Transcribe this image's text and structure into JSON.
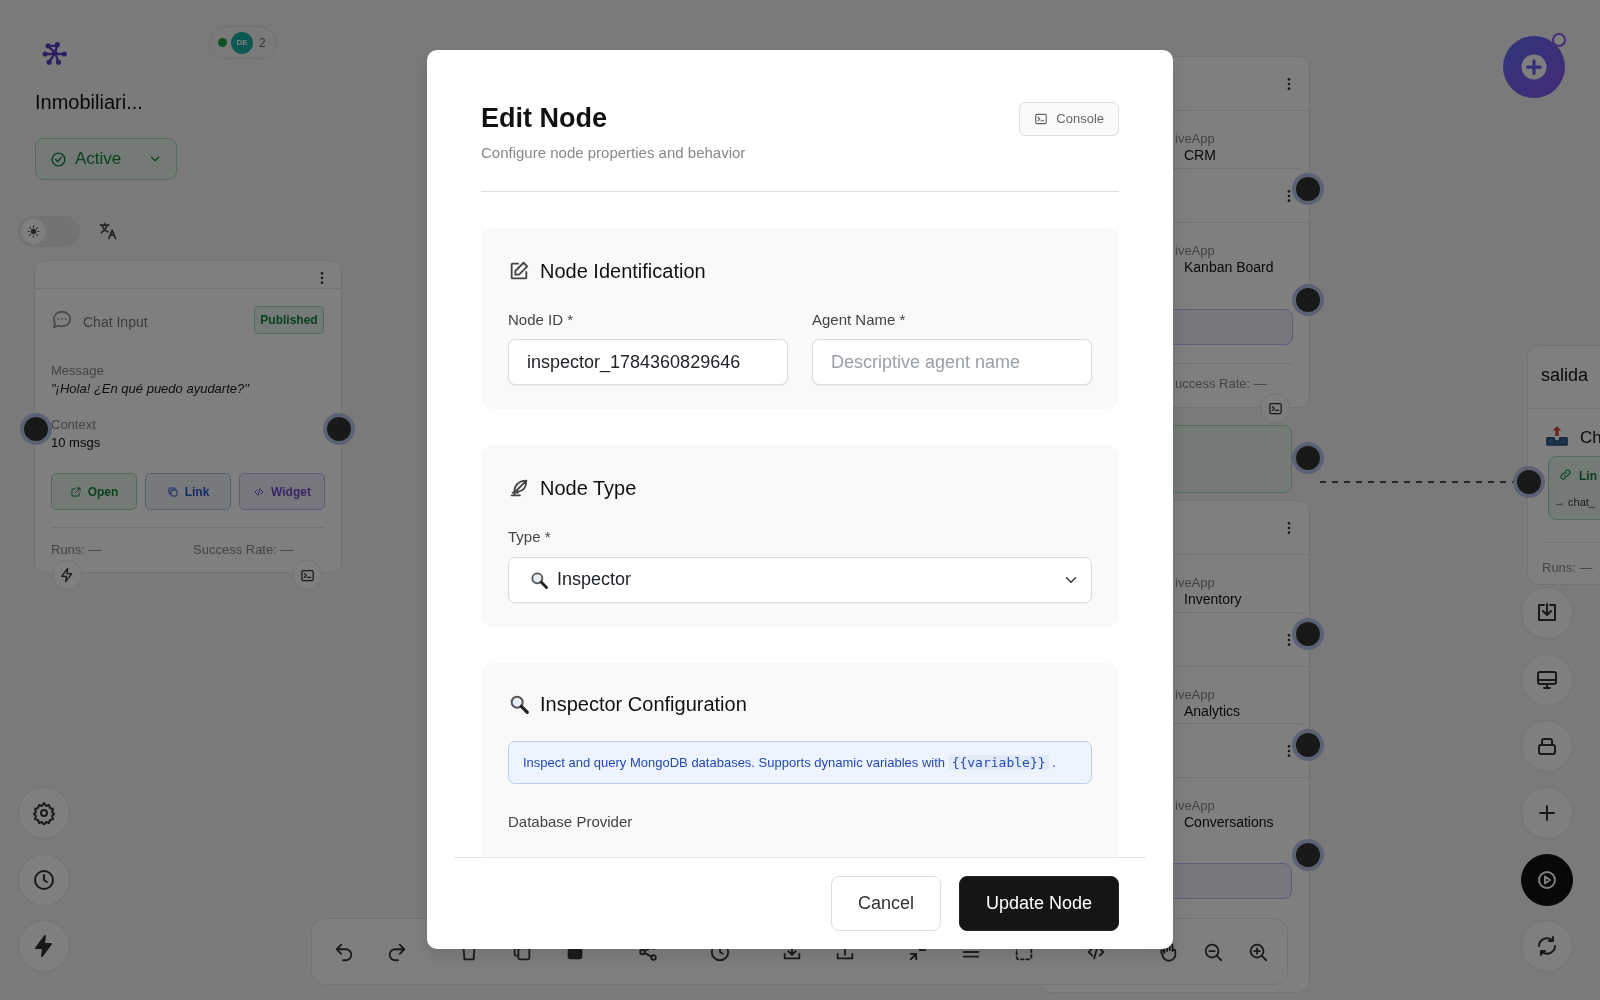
{
  "workflow_panel": {
    "title": "Inmobiliari...",
    "status": "Active"
  },
  "presence": {
    "avatar": "DE",
    "count": "2"
  },
  "theme_toggle": {
    "dark": false
  },
  "chat_input_node": {
    "type_label": "Chat Input",
    "badge": "Published",
    "fields": [
      {
        "label": "Message",
        "value": "\"¡Hola! ¿En qué puedo ayudarte?\"",
        "kind": "quote"
      },
      {
        "label": "Context",
        "value": "10 msgs",
        "kind": "text"
      }
    ],
    "actions": [
      {
        "label": "Open",
        "kind": "open"
      },
      {
        "label": "Link",
        "kind": "link"
      },
      {
        "label": "Widget",
        "kind": "widget"
      }
    ],
    "runs": "Runs: —",
    "success_rate": "Success Rate: —"
  },
  "side_nodes": [
    {
      "app": "iveApp",
      "name": "CRM"
    },
    {
      "app": "iveApp",
      "name": "Kanban Board",
      "success_rate": "uccess Rate: —"
    },
    {
      "app": "iveApp",
      "name": "Inventory"
    },
    {
      "app": "iveApp",
      "name": "Analytics"
    },
    {
      "app": "iveApp",
      "name": "Conversations"
    }
  ],
  "output_node": {
    "title": "salida",
    "name": "Ch",
    "link": "Lin",
    "target": "→ chat_",
    "runs": "Runs: —"
  },
  "modal": {
    "title": "Edit Node",
    "subtitle": "Configure node properties and behavior",
    "console_button": "Console",
    "sections": [
      {
        "kind": "identification",
        "title": "Node Identification",
        "fields": [
          {
            "label": "Node ID *",
            "value": "inspector_1784360829646"
          },
          {
            "label": "Agent Name *",
            "placeholder": "Descriptive agent name"
          }
        ]
      },
      {
        "kind": "type",
        "title": "Node Type",
        "fields": [
          {
            "label": "Type *",
            "value": "Inspector"
          }
        ]
      },
      {
        "kind": "config",
        "title": "Inspector Configuration",
        "info_text": "Inspect and query MongoDB databases. Supports dynamic variables with",
        "info_code": "{{variable}}",
        "info_end": ".",
        "next_label": "Database Provider"
      }
    ],
    "buttons": [
      {
        "label": "Cancel",
        "kind": "secondary"
      },
      {
        "label": "Update Node",
        "kind": "primary"
      }
    ]
  }
}
